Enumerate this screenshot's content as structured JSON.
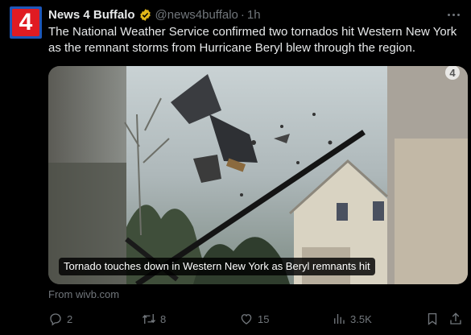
{
  "author": {
    "name": "News 4 Buffalo",
    "handle": "@news4buffalo",
    "separator": "·",
    "time": "1h",
    "avatar_text": "4"
  },
  "post": {
    "text": "The National Weather Service confirmed two tornados hit Western New York as the remnant storms from Hurricane Beryl blew through the region."
  },
  "media": {
    "caption": "Tornado touches down in Western New York as Beryl remnants hit",
    "watermark": "4"
  },
  "source": "From wivb.com",
  "actions": {
    "replies": "2",
    "reposts": "8",
    "likes": "15",
    "views": "3.5K"
  },
  "colors": {
    "background": "#000000",
    "text": "#e7e9ea",
    "muted": "#71767b",
    "verified_badge": "#e2b719",
    "avatar_red": "#e01b22",
    "avatar_blue": "#1d57b9"
  },
  "icons": [
    "more-icon",
    "verified-icon",
    "reply-icon",
    "repost-icon",
    "like-icon",
    "views-icon",
    "bookmark-icon",
    "share-icon"
  ]
}
